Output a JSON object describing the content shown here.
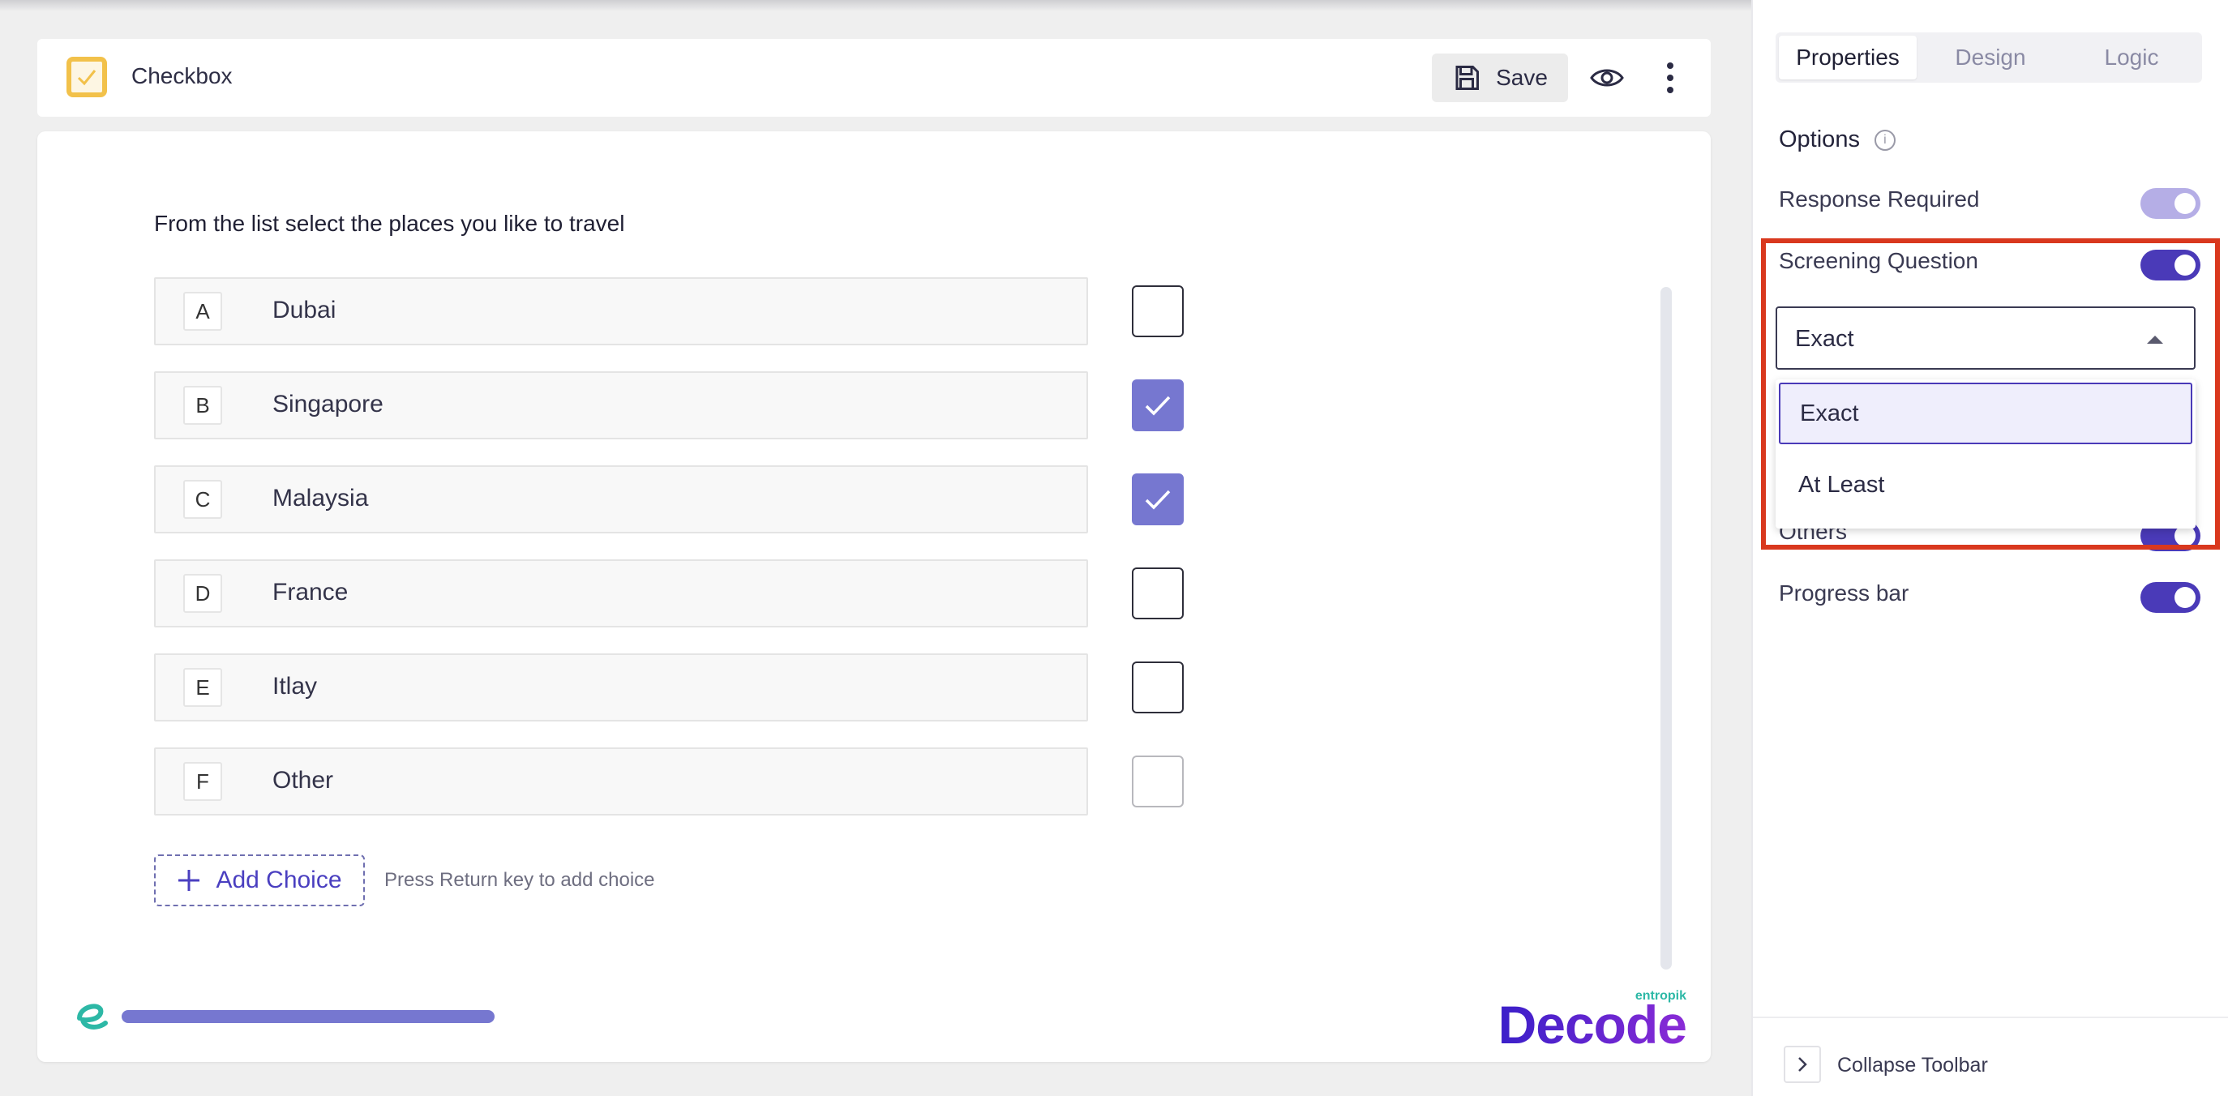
{
  "header": {
    "title": "Checkbox",
    "save_label": "Save"
  },
  "question": {
    "text": "From the list select the places you like to travel",
    "choices": [
      {
        "letter": "A",
        "label": "Dubai",
        "checked": false
      },
      {
        "letter": "B",
        "label": "Singapore",
        "checked": true
      },
      {
        "letter": "C",
        "label": "Malaysia",
        "checked": true
      },
      {
        "letter": "D",
        "label": "France",
        "checked": false
      },
      {
        "letter": "E",
        "label": "Itlay",
        "checked": false
      },
      {
        "letter": "F",
        "label": "Other",
        "checked": false
      }
    ],
    "add_choice_label": "Add Choice",
    "add_choice_hint": "Press Return key to add choice"
  },
  "brand": {
    "sub": "entropik",
    "name": "Decode"
  },
  "panel": {
    "tabs": [
      "Properties",
      "Design",
      "Logic"
    ],
    "active_tab": "Properties",
    "options_title": "Options",
    "response_required_label": "Response Required",
    "screening_question_label": "Screening Question",
    "screening_select_value": "Exact",
    "screening_options": [
      "Exact",
      "At Least"
    ],
    "others_label": "Others",
    "progress_bar_label": "Progress bar",
    "collapse_label": "Collapse Toolbar"
  },
  "colors": {
    "accent": "#4a3ab8",
    "checked": "#7677d0",
    "highlight": "#d9381e"
  }
}
